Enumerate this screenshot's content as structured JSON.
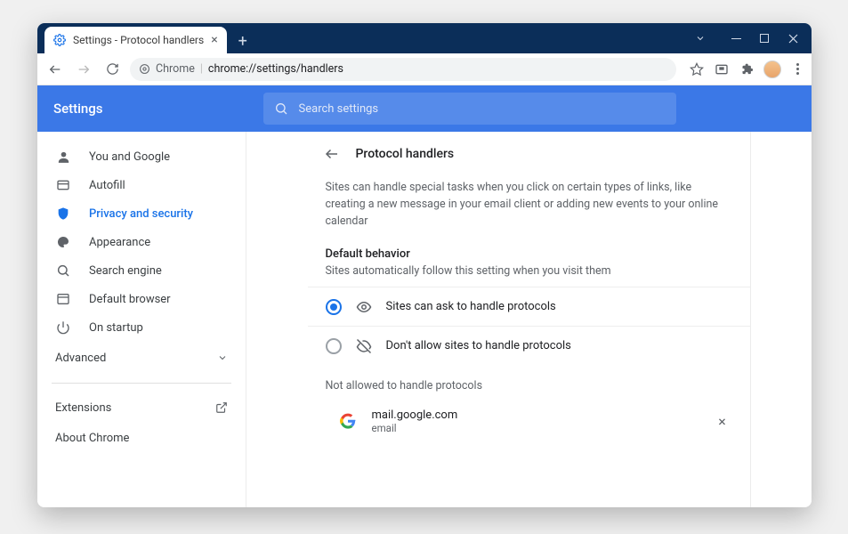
{
  "tab": {
    "title": "Settings - Protocol handlers"
  },
  "omnibox": {
    "scheme_label": "Chrome",
    "url": "chrome://settings/handlers"
  },
  "header": {
    "title": "Settings",
    "search_placeholder": "Search settings"
  },
  "sidebar": {
    "items": [
      {
        "label": "You and Google"
      },
      {
        "label": "Autofill"
      },
      {
        "label": "Privacy and security"
      },
      {
        "label": "Appearance"
      },
      {
        "label": "Search engine"
      },
      {
        "label": "Default browser"
      },
      {
        "label": "On startup"
      }
    ],
    "advanced_label": "Advanced",
    "extensions_label": "Extensions",
    "about_label": "About Chrome"
  },
  "page": {
    "title": "Protocol handlers",
    "description": "Sites can handle special tasks when you click on certain types of links, like creating a new message in your email client or adding new events to your online calendar",
    "default_behavior_label": "Default behavior",
    "default_behavior_sub": "Sites automatically follow this setting when you visit them",
    "options": [
      {
        "label": "Sites can ask to handle protocols",
        "checked": true
      },
      {
        "label": "Don't allow sites to handle protocols",
        "checked": false
      }
    ],
    "blocked_label": "Not allowed to handle protocols",
    "blocked_sites": [
      {
        "name": "mail.google.com",
        "protocol": "email"
      }
    ]
  }
}
